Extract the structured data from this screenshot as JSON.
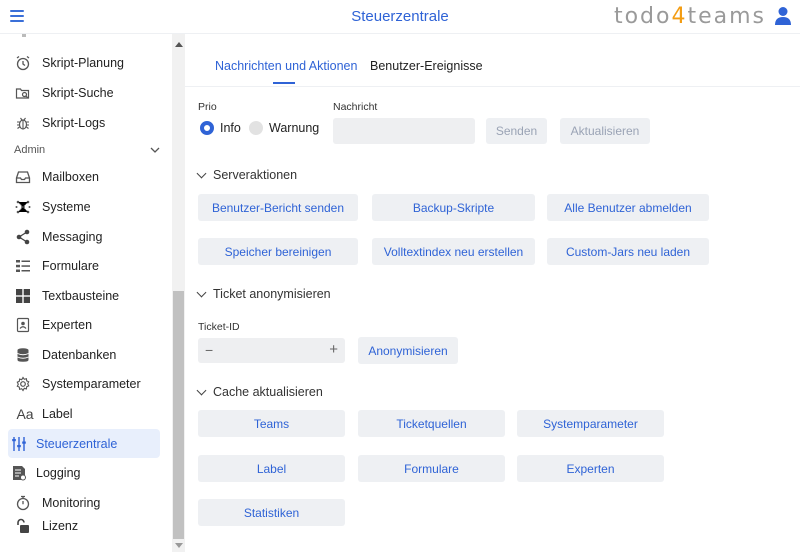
{
  "header": {
    "menu_icon": "hamburger-icon",
    "title": "Steuerzentrale",
    "brand_prefix": "todo",
    "brand_digit": "4",
    "brand_suffix": "teams",
    "user_icon": "user-icon",
    "accent_color": "#2f63d6",
    "brand_accent_color": "#f39c12"
  },
  "sidebar": {
    "items_top": [
      {
        "label": "Skript-Planung",
        "icon": "alarm-clock-icon"
      },
      {
        "label": "Skript-Suche",
        "icon": "folder-search-icon"
      },
      {
        "label": "Skript-Logs",
        "icon": "bug-icon"
      }
    ],
    "section_admin": "Admin",
    "items_admin": [
      {
        "label": "Mailboxen",
        "icon": "inbox-icon"
      },
      {
        "label": "Systeme",
        "icon": "network-icon"
      },
      {
        "label": "Messaging",
        "icon": "share-icon"
      },
      {
        "label": "Formulare",
        "icon": "list-form-icon"
      },
      {
        "label": "Textbausteine",
        "icon": "grid-icon"
      },
      {
        "label": "Experten",
        "icon": "badge-icon"
      },
      {
        "label": "Datenbanken",
        "icon": "database-icon"
      },
      {
        "label": "Systemparameter",
        "icon": "gear-icon"
      },
      {
        "label": "Label",
        "icon": "text-aa-icon"
      },
      {
        "label": "Steuerzentrale",
        "icon": "sliders-icon",
        "active": true
      },
      {
        "label": "Logging",
        "icon": "log-file-icon"
      },
      {
        "label": "Monitoring",
        "icon": "stopwatch-icon"
      },
      {
        "label": "Lizenz",
        "icon": "unlock-icon"
      }
    ]
  },
  "tabs": [
    {
      "label": "Nachrichten und Aktionen",
      "active": true
    },
    {
      "label": "Benutzer-Ereignisse",
      "active": false
    }
  ],
  "message": {
    "prio_label": "Prio",
    "prio_options": [
      {
        "label": "Info",
        "selected": true
      },
      {
        "label": "Warnung",
        "selected": false
      }
    ],
    "nachricht_label": "Nachricht",
    "nachricht_value": "",
    "send_label": "Senden",
    "refresh_label": "Aktualisieren"
  },
  "server_actions": {
    "title": "Serveraktionen",
    "buttons": [
      "Benutzer-Bericht senden",
      "Backup-Skripte",
      "Alle Benutzer abmelden",
      "Speicher bereinigen",
      "Volltextindex neu erstellen",
      "Custom-Jars neu laden"
    ]
  },
  "ticket_anon": {
    "title": "Ticket anonymisieren",
    "id_label": "Ticket-ID",
    "id_value": "",
    "minus": "−",
    "plus": "+",
    "button": "Anonymisieren"
  },
  "cache": {
    "title": "Cache aktualisieren",
    "buttons": [
      "Teams",
      "Ticketquellen",
      "Systemparameter",
      "Label",
      "Formulare",
      "Experten",
      "Statistiken"
    ]
  }
}
